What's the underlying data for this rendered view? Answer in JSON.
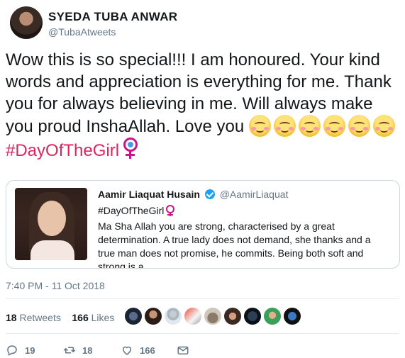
{
  "author": {
    "name": "SYEDA TUBA ANWAR",
    "handle": "@TubaAtweets"
  },
  "tweet": {
    "text": "Wow this is so special!!! I am honoured. Your kind words and appreciation is everything for me. Thank you for always believing in me. Will always make you proud InshaAllah. Love you",
    "hashtag": "#DayOfTheGirl"
  },
  "quoted": {
    "name": "Aamir Liaquat Husain",
    "handle": "@AamirLiaquat",
    "hashtag": "#DayOfTheGirl",
    "body": "Ma Sha Allah you are strong,  characterised by a great determination. A true lady does not demand, she thanks and a true man does not promise, he commits. Being both soft and strong is a"
  },
  "timestamp": "7:40 PM - 11 Oct 2018",
  "stats": {
    "retweets_count": "18",
    "retweets_label": "Retweets",
    "likes_count": "166",
    "likes_label": "Likes"
  },
  "actions": {
    "replies": "19",
    "retweets": "18",
    "likes": "166"
  },
  "colors": {
    "hashtag": "#e0245e",
    "secondary": "#657786",
    "verified": "#1da1f2"
  }
}
